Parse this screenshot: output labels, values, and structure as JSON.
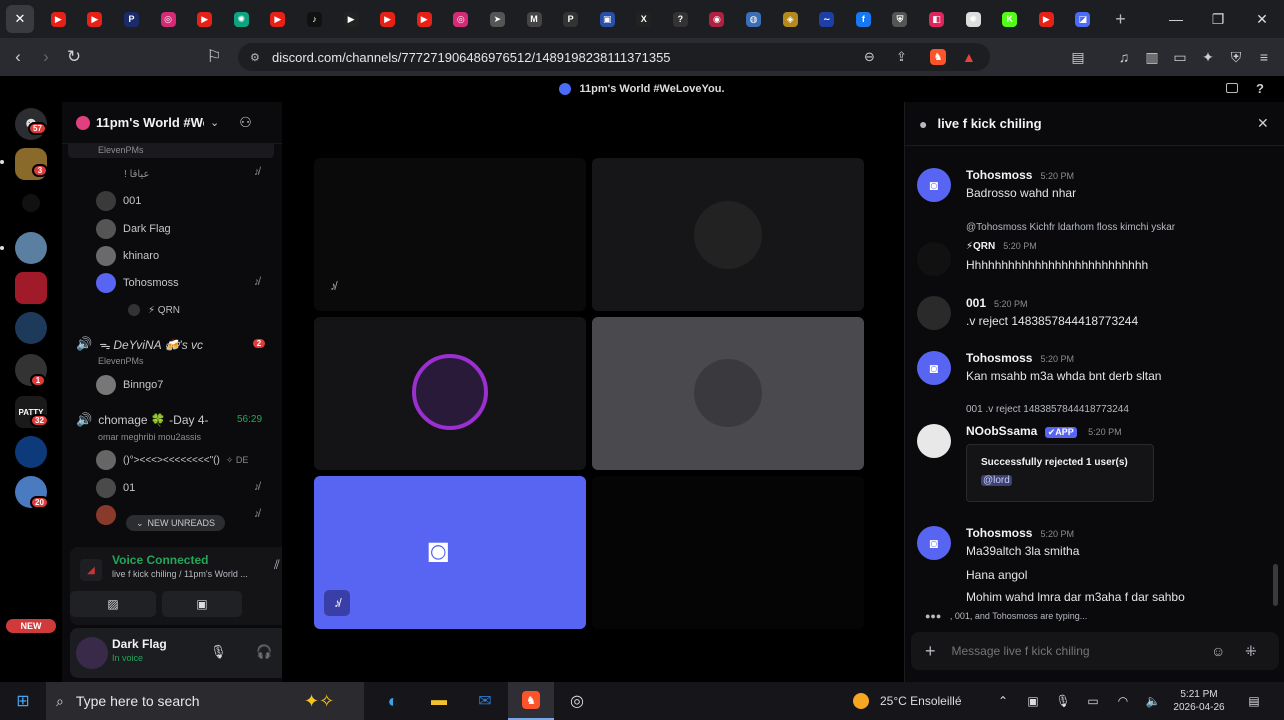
{
  "browser": {
    "url": "discord.com/channels/777271906486976512/1489198238111371355",
    "tabs": [
      {
        "icon": "youtube-icon",
        "color": "#e62117",
        "glyph": "▶"
      },
      {
        "icon": "youtube-icon",
        "color": "#e62117",
        "glyph": "▶"
      },
      {
        "icon": "paypal-icon",
        "color": "#1b2a6b",
        "glyph": "P"
      },
      {
        "icon": "instagram-icon",
        "color": "#d62976",
        "glyph": "◎"
      },
      {
        "icon": "youtube-icon",
        "color": "#e62117",
        "glyph": "▶"
      },
      {
        "icon": "chatgpt-icon",
        "color": "#10a37f",
        "glyph": "✺"
      },
      {
        "icon": "youtube-icon",
        "color": "#e62117",
        "glyph": "▶"
      },
      {
        "icon": "tiktok-icon",
        "color": "#111111",
        "glyph": "♪"
      },
      {
        "icon": "play-icon",
        "color": "#222222",
        "glyph": "▶"
      },
      {
        "icon": "youtube-icon",
        "color": "#e62117",
        "glyph": "▶"
      },
      {
        "icon": "youtube-icon",
        "color": "#e62117",
        "glyph": "▶"
      },
      {
        "icon": "instagram-icon",
        "color": "#d62976",
        "glyph": "◎"
      },
      {
        "icon": "cursor-icon",
        "color": "#555555",
        "glyph": "➤"
      },
      {
        "icon": "gmail-icon",
        "color": "#444444",
        "glyph": "M"
      },
      {
        "icon": "p-icon",
        "color": "#333333",
        "glyph": "P"
      },
      {
        "icon": "brand-icon",
        "color": "#2a4fa8",
        "glyph": "▣"
      },
      {
        "icon": "x-icon",
        "color": "#222222",
        "glyph": "X"
      },
      {
        "icon": "help-icon",
        "color": "#333333",
        "glyph": "?"
      },
      {
        "icon": "target-icon",
        "color": "#b02040",
        "glyph": "◉"
      },
      {
        "icon": "globe-icon",
        "color": "#3a6fb5",
        "glyph": "◍"
      },
      {
        "icon": "coin-icon",
        "color": "#b58a1a",
        "glyph": "◈"
      },
      {
        "icon": "wave-icon",
        "color": "#1d3fa8",
        "glyph": "∼"
      },
      {
        "icon": "facebook-icon",
        "color": "#1877f2",
        "glyph": "f"
      },
      {
        "icon": "shield-icon",
        "color": "#555555",
        "glyph": "⛨"
      },
      {
        "icon": "app-icon",
        "color": "#e0245e",
        "glyph": "◧"
      },
      {
        "icon": "openai-icon",
        "color": "#dddddd",
        "glyph": "✺"
      },
      {
        "icon": "kick-icon",
        "color": "#53fc18",
        "glyph": "K"
      },
      {
        "icon": "youtube-icon",
        "color": "#e62117",
        "glyph": "▶"
      },
      {
        "icon": "discord-tab-icon",
        "color": "#4a6cf7",
        "glyph": "◪"
      }
    ]
  },
  "discord": {
    "window_title": "11pm's World #WeLoveYou.",
    "server_name": "11pm's World #WeL...",
    "server_badges": [
      "57",
      "3",
      "1",
      "32",
      "20"
    ],
    "new_badge": "NEW",
    "channel_sub_top": "ElevenPMs",
    "channel_top_item": "! عياقا",
    "users_a": [
      {
        "name": "001",
        "color": "#3a3a3a"
      },
      {
        "name": "Dark Flag",
        "color": "#555555"
      },
      {
        "name": "khinaro",
        "color": "#6a6a6a"
      },
      {
        "name": "Tohosmoss",
        "color": "#5865f2"
      }
    ],
    "qrn_tag": "⚡ QRN",
    "vc2": {
      "name": "ᯓ DeYviNA 🍻's vc",
      "badge": "2",
      "sub": "ElevenPMs",
      "user": "Binngo7"
    },
    "vc3": {
      "name": "chomage 🍀 -Day 4-",
      "time": "56:29",
      "sub": "omar meghribi mou2assis",
      "users": [
        {
          "name": "()°><<<><<<<<<<<\"()",
          "extra": "✧ DE"
        },
        {
          "name": "01",
          "extra": ""
        }
      ]
    },
    "new_unreads": "NEW UNREADS",
    "voice_connected": "Voice Connected",
    "voice_channel": "live f kick chiling / 11pm's World ...",
    "user_name": "Dark Flag",
    "user_status": "In voice",
    "chat_title": "live f kick chiling",
    "messages": [
      {
        "author": "Tohosmoss",
        "time": "5:20 PM",
        "text": "Badrosso wahd nhar"
      },
      {
        "reply_to": "@Tohosmoss Kichfr ldarhom floss kimchi yskar",
        "author": "⚡QRN",
        "time": "5:20 PM",
        "text": "Hhhhhhhhhhhhhhhhhhhhhhhhhhh"
      },
      {
        "author": "001",
        "time": "5:20 PM",
        "text": ".v reject 1483857844418773244"
      },
      {
        "author": "Tohosmoss",
        "time": "5:20 PM",
        "text": "Kan msahb m3a whda bnt derb sltan"
      },
      {
        "reply_to": "001 .v reject 1483857844418773244",
        "author": "NOobSsama",
        "app": "✔APP",
        "time": "5:20 PM",
        "embed_title": "Successfully rejected 1 user(s)",
        "embed_mention": "@lord"
      },
      {
        "author": "Tohosmoss",
        "time": "5:20 PM",
        "lines": [
          "Ma39altch 3la smitha",
          "Hana angol",
          "Mohim wahd lmra dar m3aha f dar sahbo"
        ]
      }
    ],
    "typing": ", 001, and Tohosmoss are typing...",
    "composer_placeholder": "Message live f kick chiling"
  },
  "taskbar": {
    "search_placeholder": "Type here to search",
    "weather": "25°C Ensoleillé",
    "time": "5:21 PM",
    "date": "2026-04-26"
  }
}
